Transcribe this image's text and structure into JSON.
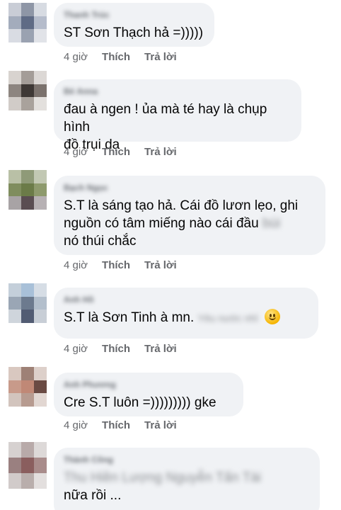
{
  "comments": [
    {
      "author": "Thanh Trúc",
      "text": "ST Sơn Thạch hả =)))))",
      "time": "4 giờ",
      "like": "Thích",
      "reply": "Trả lời"
    },
    {
      "author": "Bé Anna",
      "text_lines": [
        "đau à ngen ! ủa mà té hay là chụp hình",
        "đồ trụi dạ"
      ],
      "time": "4 giờ",
      "like": "Thích",
      "reply": "Trả lời"
    },
    {
      "author": "Bạch Ngọc",
      "text_line1": "S.T là sáng tạo hả. Cái đồ lươn lẹo, ghi",
      "text_line2": "nguồn có tâm miếng nào cái đầu",
      "text_line2_blurred": "bùi",
      "text_line3": "nó thúi chắc",
      "time": "4 giờ",
      "like": "Thích",
      "reply": "Trả lời"
    },
    {
      "author": "Anh Hồ",
      "text": "S.T là Sơn Tinh à mn.",
      "text_blurred": "Yêu nước nhỉ",
      "emoji": "slightly-smiling-face",
      "time": "4 giờ",
      "like": "Thích",
      "reply": "Trả lời"
    },
    {
      "author": "Anh Phương",
      "text": "Cre S.T luôn =))))))))) gke",
      "time": "4 giờ",
      "like": "Thích",
      "reply": "Trả lời"
    },
    {
      "author": "Thành Công",
      "text_blurred": "Thu Hiền Lượng Nguyễn Tấn Tài",
      "text_line2": "nữa rồi ..."
    }
  ]
}
